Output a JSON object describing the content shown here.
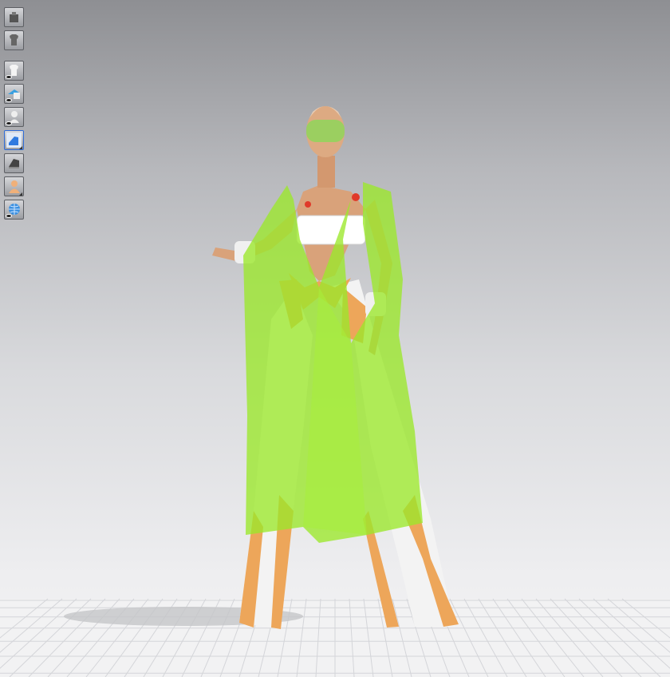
{
  "viewport": {
    "background_top": "#8e8f93",
    "background_bottom": "#f3f3f4",
    "floor_grid_color": "#d4d5d9"
  },
  "toolbar": {
    "buttons": [
      {
        "icon": "avatar-camera-icon",
        "active": false,
        "eye": false
      },
      {
        "icon": "garment-settings-icon",
        "active": false,
        "eye": false
      },
      {
        "icon": "show-garment-icon",
        "active": false,
        "eye": true
      },
      {
        "icon": "show-avatar-pose-icon",
        "active": false,
        "eye": true
      },
      {
        "icon": "show-avatar-icon",
        "active": false,
        "eye": true
      },
      {
        "icon": "texture-mode-icon",
        "active": true,
        "eye": false
      },
      {
        "icon": "shading-icon",
        "active": false,
        "eye": false
      },
      {
        "icon": "skin-mode-icon",
        "active": false,
        "eye": false
      },
      {
        "icon": "world-grid-icon",
        "active": false,
        "eye": true
      }
    ]
  },
  "model": {
    "robe_color": "#9be82a",
    "pants_color": "#f2f2f2",
    "trim_color": "#eda65a",
    "visor_color": "#8fd65a",
    "top_color": "#ffffff"
  }
}
